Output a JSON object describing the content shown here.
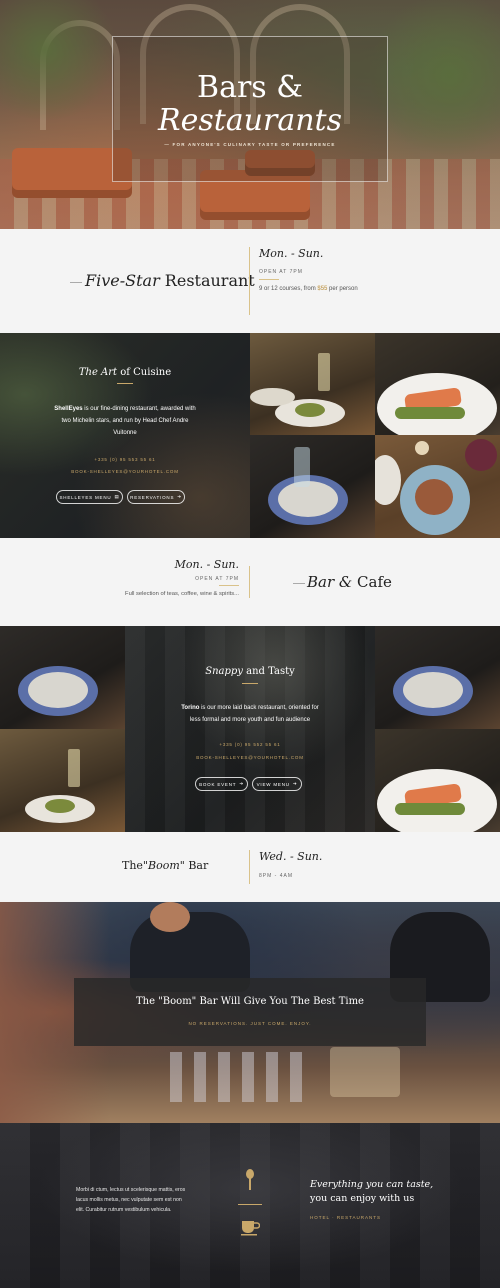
{
  "hero": {
    "title_line1": "Bars &",
    "title_line2": "Restaurants",
    "subtitle": "— FOR ANYONE'S CULINARY TASTE OR PREFERENCE"
  },
  "five_star": {
    "title_italic": "Five-Star",
    "title_rest": " Restaurant",
    "days": "Mon. - Sun.",
    "open": "OPEN AT 7PM",
    "courses_prefix": "9 or 12 courses, from ",
    "courses_price": "$55",
    "courses_suffix": " per person"
  },
  "cuisine": {
    "heading_italic": "The Art",
    "heading_rest": " of Cuisine",
    "brand": "ShellEyes",
    "desc": " is our fine-dining restaurant, awarded with two Michelin stars, and run by Head Chef Andre Vuitonne",
    "phone": "+335 (0) 95 553 55 61",
    "email": "BOOK-SHELLEYES@YOURHOTEL.COM",
    "btn_menu": "SHELLEYES MENU",
    "btn_reserve": "RESERVATIONS"
  },
  "bar_cafe": {
    "days": "Mon. - Sun.",
    "open": "OPEN AT 7PM",
    "desc": "Full selection of teas, coffee, wine & spirits...",
    "title_italic": "Bar",
    "title_amp": " & ",
    "title_rest": "Cafe"
  },
  "snappy": {
    "heading_italic": "Snappy",
    "heading_rest": " and Tasty",
    "brand": "Torino",
    "desc": " is our more laid back restaurant, oriented for less formal and more youth and fun audience",
    "phone": "+335 (0) 95 552 55 61",
    "email": "BOOK-SHELLEYES@YOURHOTEL.COM",
    "btn_book": "BOOK EVENT",
    "btn_menu": "VIEW MENU"
  },
  "boom": {
    "title_pre": "The\"",
    "title_italic": "Boom",
    "title_post": "\" Bar",
    "days": "Wed. - Sun.",
    "hours": "8PM - 4AM",
    "banner_title": "The \"Boom\" Bar Will Give You The Best Time",
    "banner_sub": "NO RESERVATIONS. JUST COME. ENJOY."
  },
  "footer": {
    "lorem": "Morbi di ctum, lectus ut scelerisque mattis, eros lacus mollis metus, nec vulputate sem est non elit. Curabitur rutrum vestibulum vehicula.",
    "tag_line1": "Everything you can taste,",
    "tag_line2": "you can enjoy with us",
    "crumb": "HOTEL · RESTAURANTS",
    "icon_top": "spoon-icon",
    "icon_bottom": "coffee-cup-icon"
  },
  "colors": {
    "gold": "#c9a86a",
    "strip_bg": "#f4f4f4",
    "dark": "#2a2a2e"
  }
}
